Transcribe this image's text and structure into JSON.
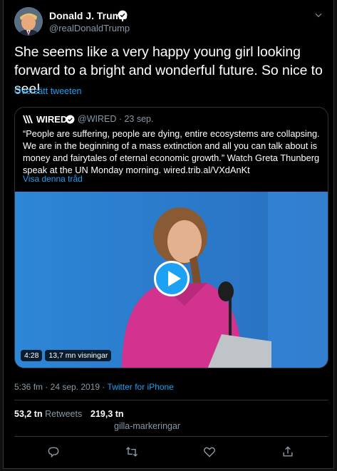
{
  "author": {
    "name": "Donald J. Trump",
    "handle": "@realDonaldTrump"
  },
  "tweet": {
    "text": "She seems like a very happy young girl looking forward to a bright and wonderful future. So nice to see!",
    "translate_label": "Översätt tweeten"
  },
  "quoted": {
    "name": "WIRED",
    "handle_date": "@WIRED · 23 sep.",
    "text": "“People are suffering, people are dying, entire ecosystems are collapsing. We are in the beginning of a mass extinction and all you can talk about is money and fairytales of eternal economic growth.” Watch Greta Thunberg speak at the UN Monday morning. wired.trib.al/VXdAnKt",
    "thread_label": "Visa denna tråd",
    "video": {
      "duration": "4:28",
      "views": "13,7 mn visningar"
    }
  },
  "meta": {
    "time_date": "5:36 fm · 24 sep. 2019 · ",
    "source": "Twitter for iPhone"
  },
  "stats": {
    "retweets_count": "53,2 tn",
    "retweets_label": "Retweets",
    "likes_count": "219,3 tn",
    "likes_label": "gilla-markeringar"
  },
  "colors": {
    "accent": "#1da1f2",
    "background": "#000000",
    "secondary_text": "#8899a6",
    "border": "#2f3336"
  },
  "icons": [
    "verified-icon",
    "chevron-down-icon",
    "wired-logo-icon",
    "play-icon",
    "reply-icon",
    "retweet-icon",
    "like-icon",
    "share-icon"
  ]
}
